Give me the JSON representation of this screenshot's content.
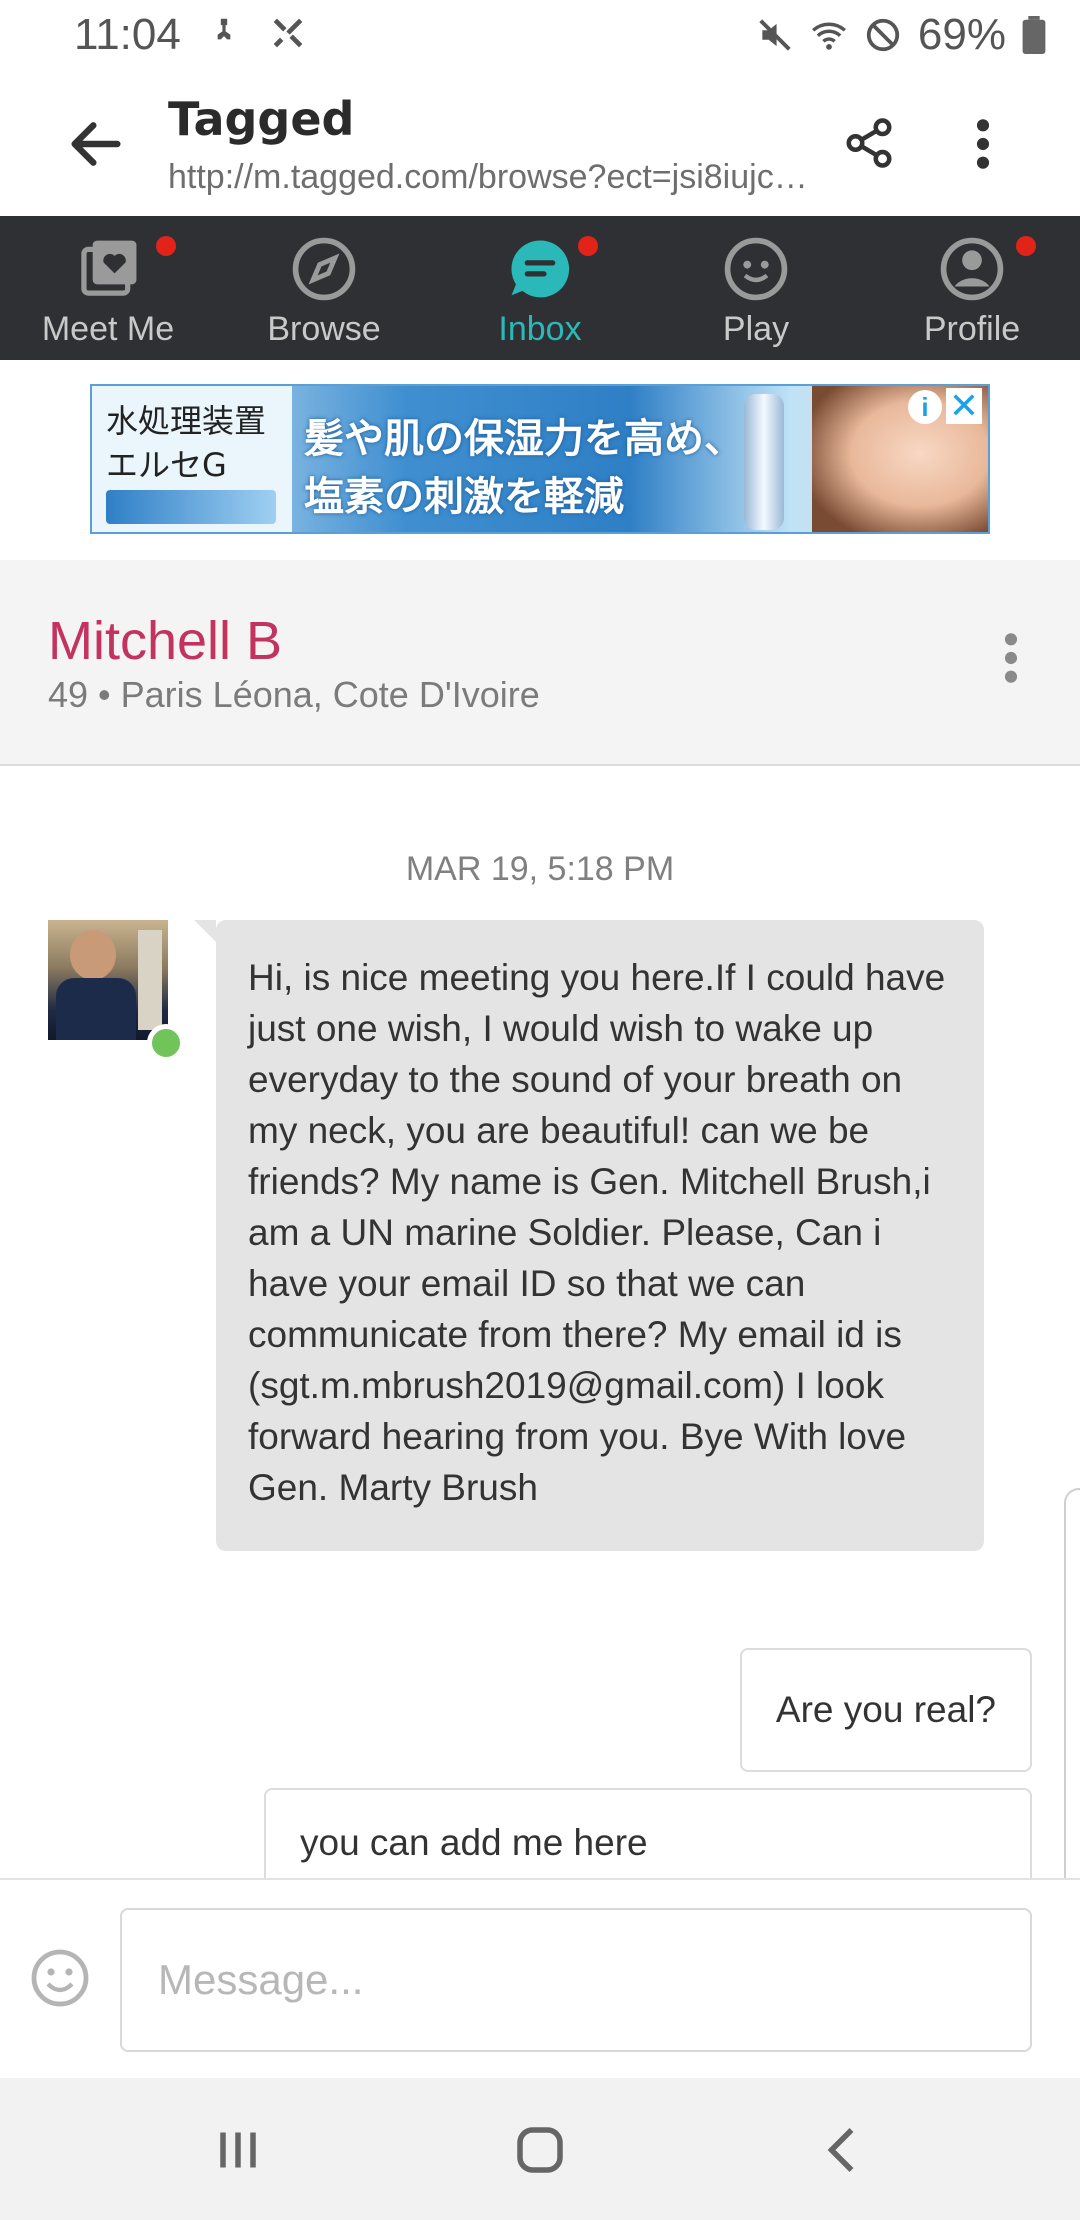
{
  "status_bar": {
    "time": "11:04",
    "battery": "69%"
  },
  "browser": {
    "title": "Tagged",
    "url": "http://m.tagged.com/browse?ect=jsi8iujc…"
  },
  "app_nav": {
    "items": [
      {
        "label": "Meet Me",
        "icon": "heart-photo-icon",
        "badge": true
      },
      {
        "label": "Browse",
        "icon": "compass-icon",
        "badge": false
      },
      {
        "label": "Inbox",
        "icon": "chat-icon",
        "badge": true,
        "active": true
      },
      {
        "label": "Play",
        "icon": "pet-face-icon",
        "badge": false
      },
      {
        "label": "Profile",
        "icon": "user-icon",
        "badge": true
      }
    ],
    "active_color": "#2ab8b9",
    "badge_color": "#e2231a"
  },
  "ad": {
    "brand_line1": "水処理装置",
    "brand_line2": "エルセG",
    "headline_line1": "髪や肌の保湿力を高め、",
    "headline_line2": "塩素の刺激を軽減",
    "info_glyph": "i",
    "close_glyph": "✕"
  },
  "profile": {
    "name": "Mitchell B",
    "details": "49 • Paris Léona, Cote D'Ivoire",
    "name_color": "#c2345f"
  },
  "chat": {
    "date": "MAR 19, 5:18 PM",
    "incoming_message": "Hi, is nice meeting you here.If I could have just one wish, I would wish to wake up everyday to the sound of your breath on my neck, you are beautiful! can we be friends? My name is Gen. Mitchell Brush,i am a UN marine Soldier. Please, Can i have your email ID so that we can communicate from there? My email id is (sgt.m.mbrush2019@gmail.com) I look forward hearing from you. Bye With love Gen. Marty Brush",
    "outgoing_message": "Are you real?",
    "outgoing_message_2": "you can add me here",
    "online_color": "#71c45a"
  },
  "composer": {
    "placeholder": "Message..."
  }
}
